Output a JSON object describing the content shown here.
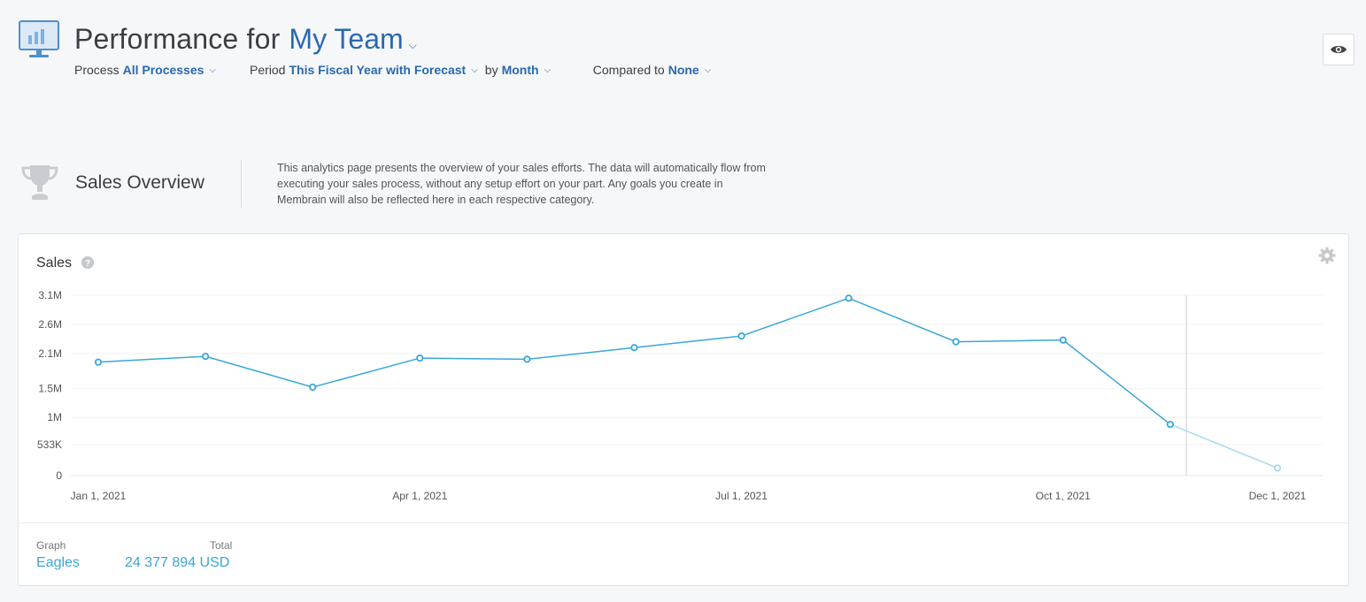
{
  "header": {
    "title_prefix": "Performance for",
    "team_name": "My Team",
    "filters": {
      "process_label": "Process",
      "process_value": "All Processes",
      "period_label": "Period",
      "period_value": "This Fiscal Year with Forecast",
      "by_label": "by",
      "by_value": "Month",
      "compared_label": "Compared to",
      "compared_value": "None"
    }
  },
  "overview": {
    "title": "Sales Overview",
    "description": "This analytics page presents the overview of your sales efforts. The data will automatically flow from executing your sales process, without any setup effort on your part. Any goals you create in Membrain will also be reflected here in each respective category."
  },
  "card": {
    "title": "Sales",
    "legend_graph_header": "Graph",
    "legend_total_header": "Total",
    "legend_series_name": "Eagles",
    "legend_total_value": "24 377 894 USD"
  },
  "colors": {
    "accent": "#2a69b0",
    "series": "#38a7d8",
    "forecast": "#a8d8ee"
  },
  "chart_data": {
    "type": "line",
    "title": "Sales",
    "y_tick_labels": [
      "0",
      "533K",
      "1M",
      "1.5M",
      "2.1M",
      "2.6M",
      "3.1M"
    ],
    "y_tick_values": [
      0,
      533000,
      1000000,
      1500000,
      2100000,
      2600000,
      3100000
    ],
    "x_tick_labels": [
      "Jan 1, 2021",
      "Apr 1, 2021",
      "Jul 1, 2021",
      "Oct 1, 2021",
      "Dec 1, 2021"
    ],
    "x_tick_months": [
      0,
      3,
      6,
      9,
      11
    ],
    "ylim": [
      0,
      3100000
    ],
    "grid": true,
    "series": [
      {
        "name": "Eagles",
        "months": [
          0,
          1,
          2,
          3,
          4,
          5,
          6,
          7,
          8,
          9,
          10,
          11
        ],
        "values": [
          1950000,
          2050000,
          1520000,
          2020000,
          2000000,
          2200000,
          2400000,
          3050000,
          2300000,
          2330000,
          880000,
          130000
        ],
        "forecast_from_index": 10
      }
    ],
    "current_marker_month": 10.15
  }
}
